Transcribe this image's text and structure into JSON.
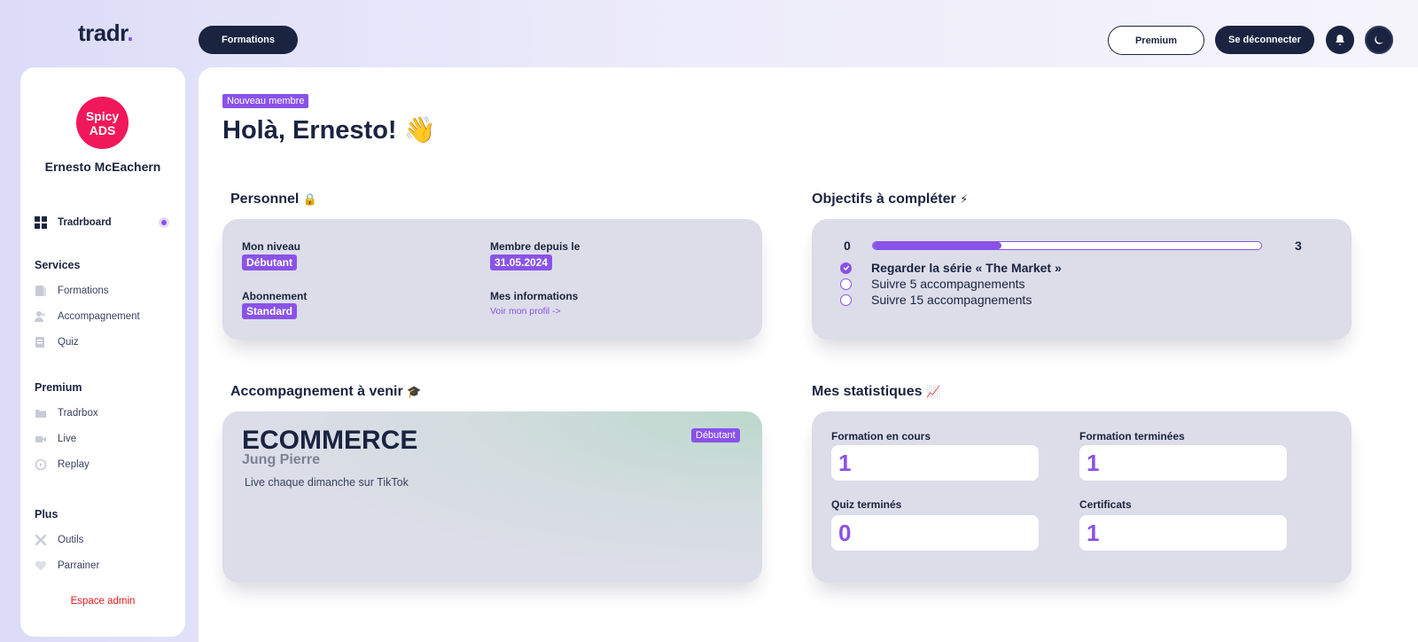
{
  "header": {
    "logo_text": "tradr",
    "logo_dot": ".",
    "nav_formations": "Formations",
    "premium_label": "Premium",
    "logout_label": "Se déconnecter"
  },
  "sidebar": {
    "avatar_line1": "Spicy",
    "avatar_line2": "ADS",
    "user_name": "Ernesto McEachern",
    "active_item": "Tradrboard",
    "sections": [
      {
        "title": "Services",
        "items": [
          "Formations",
          "Accompagnement",
          "Quiz"
        ]
      },
      {
        "title": "Premium",
        "items": [
          "Tradrbox",
          "Live",
          "Replay"
        ]
      },
      {
        "title": "Plus",
        "items": [
          "Outils",
          "Parrainer"
        ]
      }
    ],
    "admin_link": "Espace admin"
  },
  "main": {
    "member_badge": "Nouveau membre",
    "greeting": "Holà, Ernesto!",
    "greeting_emoji": "👋",
    "personnel": {
      "title": "Personnel",
      "title_emoji": "🔒",
      "level_label": "Mon niveau",
      "level_value": "Débutant",
      "member_since_label": "Membre depuis le",
      "member_since_value": "31.05.2024",
      "subscription_label": "Abonnement",
      "subscription_value": "Standard",
      "info_label": "Mes informations",
      "info_link": "Voir mon profil ->"
    },
    "objectifs": {
      "title": "Objectifs à compléter",
      "title_emoji": "⚡",
      "min": "0",
      "max": "3",
      "progress_fraction": 0.33,
      "items": [
        {
          "label": "Regarder la série « The Market »",
          "done": true
        },
        {
          "label": "Suivre 5 accompagnements",
          "done": false
        },
        {
          "label": "Suivre 15 accompagnements",
          "done": false
        }
      ]
    },
    "accompagnement": {
      "title": "Accompagnement à venir",
      "title_emoji": "🎓",
      "name": "ECOMMERCE",
      "coach": "Jung Pierre",
      "level": "Débutant",
      "description": "Live chaque dimanche sur TikTok"
    },
    "statistiques": {
      "title": "Mes statistiques",
      "title_emoji": "📈",
      "formation_en_cours_label": "Formation en cours",
      "formation_en_cours_value": "1",
      "formation_terminees_label": "Formation terminées",
      "formation_terminees_value": "1",
      "quiz_termines_label": "Quiz terminés",
      "quiz_termines_value": "0",
      "certificats_label": "Certificats",
      "certificats_value": "1"
    }
  },
  "colors": {
    "navy": "#1a2340",
    "accent": "#8a52e8",
    "card_bg": "#dcdde9",
    "avatar_bg": "#f0185a",
    "admin_red": "#e01818"
  }
}
